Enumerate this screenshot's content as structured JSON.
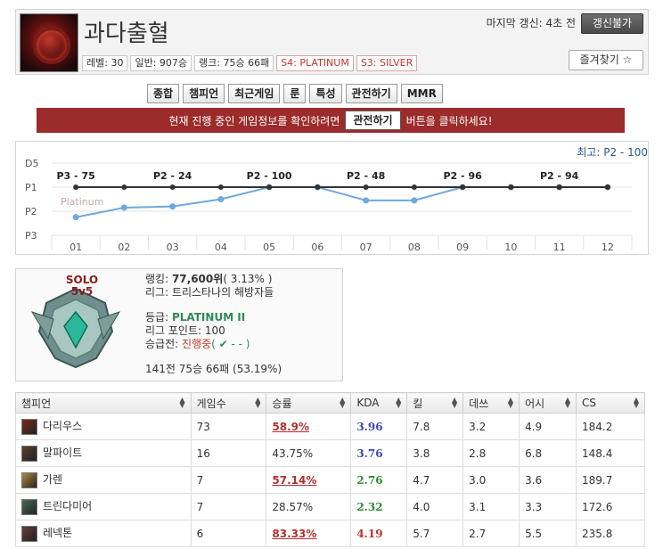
{
  "summoner": {
    "name": "과다출혈",
    "last_update": "마지막 갱신: 4초 전",
    "update_button": "갱신불가",
    "favorite_button": "즐겨찾기 ☆",
    "chips": [
      "레벨: 30",
      "일반: 907승",
      "랭크: 75승 66패",
      "S4: PLATINUM",
      "S3: SILVER"
    ]
  },
  "tabs": [
    "종합",
    "챔피언",
    "최근게임",
    "룬",
    "특성",
    "관전하기",
    "MMR"
  ],
  "spectate": {
    "text_before": "현재 진행 중인 게임정보를 확인하려면",
    "button": "관전하기",
    "text_after": "버튼을 클릭하세요!"
  },
  "chart_data": {
    "type": "line",
    "best_label": "최고: P2 - 100",
    "y_ticks": [
      "D5",
      "P1",
      "P2",
      "P3"
    ],
    "x": [
      "01",
      "02",
      "03",
      "04",
      "05",
      "06",
      "07",
      "08",
      "09",
      "10",
      "11",
      "12"
    ],
    "series": [
      {
        "color": "#6fa8dc",
        "values": [
          2.25,
          1.85,
          1.8,
          1.5,
          1.0,
          1.0,
          1.55,
          1.55,
          1.0,
          1.0,
          1.0,
          1.0
        ]
      },
      {
        "color": "#333333",
        "values": [
          1,
          1,
          1,
          1,
          1,
          1,
          1,
          1,
          1,
          1,
          1,
          1
        ]
      }
    ],
    "point_labels": [
      {
        "i": 0,
        "text": "P3 - 75"
      },
      {
        "i": 2,
        "text": "P2 - 24"
      },
      {
        "i": 4,
        "text": "P2 - 100"
      },
      {
        "i": 6,
        "text": "P2 - 48"
      },
      {
        "i": 8,
        "text": "P2 - 96"
      },
      {
        "i": 10,
        "text": "P2 - 94"
      }
    ],
    "watermark": "Platinum",
    "ylim": [
      0,
      3
    ]
  },
  "rank": {
    "queue": "SOLO",
    "queue_type": "5v5",
    "ranking_label": "랭킹:",
    "ranking_value": "77,600위",
    "ranking_pct": "( 3.13% )",
    "league": "리그: 트리스타나의 해방자들",
    "tier_label": "등급:",
    "tier": "PLATINUM II",
    "points": "리그 포인트: 100",
    "promo_label": "승급전:",
    "promo_status": "진행중",
    "promo_marks": "( ✔ - - )",
    "record": "141전 75승 66패 (53.19%)"
  },
  "table": {
    "headers": [
      "챔피언",
      "게임수",
      "승률",
      "KDA",
      "킬",
      "데쓰",
      "어시",
      "CS"
    ],
    "rows": [
      {
        "icon_color": "#7a2a1a",
        "champ": "다리우스",
        "games": "73",
        "wr": "58.9%",
        "wr_hi": true,
        "kda": "3.96",
        "kda_color": "#3a4ab0",
        "k": "7.8",
        "d": "3.2",
        "a": "4.9",
        "cs": "184.2"
      },
      {
        "icon_color": "#5a4030",
        "champ": "말파이트",
        "games": "16",
        "wr": "43.75%",
        "wr_hi": false,
        "kda": "3.76",
        "kda_color": "#3a4ab0",
        "k": "3.8",
        "d": "2.8",
        "a": "6.8",
        "cs": "148.4"
      },
      {
        "icon_color": "#b08a40",
        "champ": "가렌",
        "games": "7",
        "wr": "57.14%",
        "wr_hi": true,
        "kda": "2.76",
        "kda_color": "#2e8b2e",
        "k": "4.7",
        "d": "3.0",
        "a": "3.6",
        "cs": "189.7"
      },
      {
        "icon_color": "#4a6a5a",
        "champ": "트린다미어",
        "games": "7",
        "wr": "28.57%",
        "wr_hi": false,
        "kda": "2.32",
        "kda_color": "#2e8b2e",
        "k": "4.0",
        "d": "3.1",
        "a": "3.3",
        "cs": "172.6"
      },
      {
        "icon_color": "#6a3a3a",
        "champ": "레넥톤",
        "games": "6",
        "wr": "83.33%",
        "wr_hi": true,
        "kda": "4.19",
        "kda_color": "#c03030",
        "k": "5.7",
        "d": "2.7",
        "a": "5.5",
        "cs": "235.8"
      }
    ]
  }
}
